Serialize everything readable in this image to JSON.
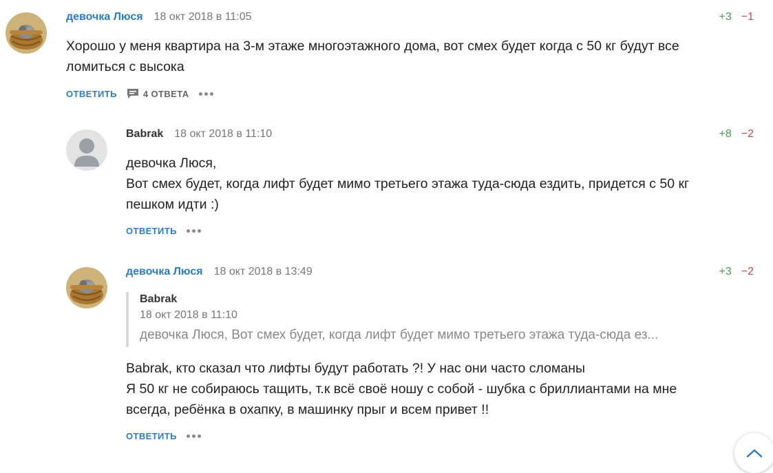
{
  "comments": [
    {
      "author": "девочка Люся",
      "date": "18 окт 2018 в 11:05",
      "votes_up": "+3",
      "votes_down": "−1",
      "lines": [
        "Хорошо у меня квартира на 3-м этаже многоэтажного дома, вот смех будет когда с 50 кг будут все",
        "ломиться с высока"
      ],
      "reply_label": "ОТВЕТИТЬ",
      "replies_label": "4 ОТВЕТА"
    },
    {
      "author": "Babrak",
      "date": "18 окт 2018 в 11:10",
      "votes_up": "+8",
      "votes_down": "−2",
      "lines": [
        "девочка Люся,",
        "Вот смех будет, когда лифт будет мимо третьего этажа туда-сюда ездить, придется с 50 кг",
        "пешком идти :)"
      ],
      "reply_label": "ОТВЕТИТЬ"
    },
    {
      "author": "девочка Люся",
      "date": "18 окт 2018 в 13:49",
      "votes_up": "+3",
      "votes_down": "−2",
      "quote": {
        "author": "Babrak",
        "date": "18 окт 2018 в 11:10",
        "text": "девочка Люся, Вот смех будет, когда лифт будет мимо третьего этажа туда-сюда ез..."
      },
      "lines": [
        "Babrak, кто сказал что лифты будут работать ?! У нас они часто сломаны",
        "Я 50 кг не собираюсь тащить, т.к всё своё ношу с собой - шубка с бриллиантами на мне",
        "всегда, ребёнка в охапку, в машинку прыг и всем привет !!"
      ],
      "reply_label": "ОТВЕТИТЬ"
    }
  ],
  "icons": {
    "replies": "comment-icon",
    "more": "more-dots-icon",
    "scroll_top": "chevron-up-icon"
  },
  "colors": {
    "link": "#2c7cc4",
    "vote_up": "#3ea052",
    "vote_down": "#d0464a"
  }
}
